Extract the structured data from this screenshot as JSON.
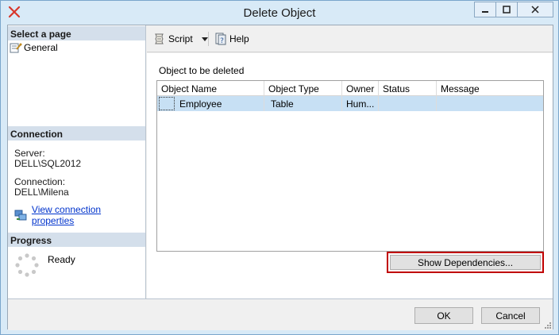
{
  "window": {
    "title": "Delete Object",
    "controls": [
      "minimize",
      "maximize",
      "close"
    ]
  },
  "left": {
    "select_page_header": "Select a page",
    "pages": [
      {
        "label": "General",
        "icon": "page-wrench-icon"
      }
    ],
    "connection_header": "Connection",
    "server_label": "Server:",
    "server_value": "DELL\\SQL2012",
    "connection_label": "Connection:",
    "connection_value": "DELL\\Milena",
    "view_connection_link": "View connection properties",
    "progress_header": "Progress",
    "progress_status": "Ready"
  },
  "toolbar": {
    "script_label": "Script",
    "help_label": "Help"
  },
  "main": {
    "objects_label": "Object to be deleted",
    "columns": [
      "Object Name",
      "Object Type",
      "Owner",
      "Status",
      "Message"
    ],
    "rows": [
      {
        "name": "Employee",
        "type": "Table",
        "owner": "Hum...",
        "status": "",
        "message": ""
      }
    ],
    "show_dependencies_label": "Show Dependencies..."
  },
  "footer": {
    "ok_label": "OK",
    "cancel_label": "Cancel"
  },
  "colors": {
    "selection": "#c7e0f4",
    "section_header": "#d4dfeb",
    "highlight_border": "#c00000",
    "link": "#0033cc"
  }
}
